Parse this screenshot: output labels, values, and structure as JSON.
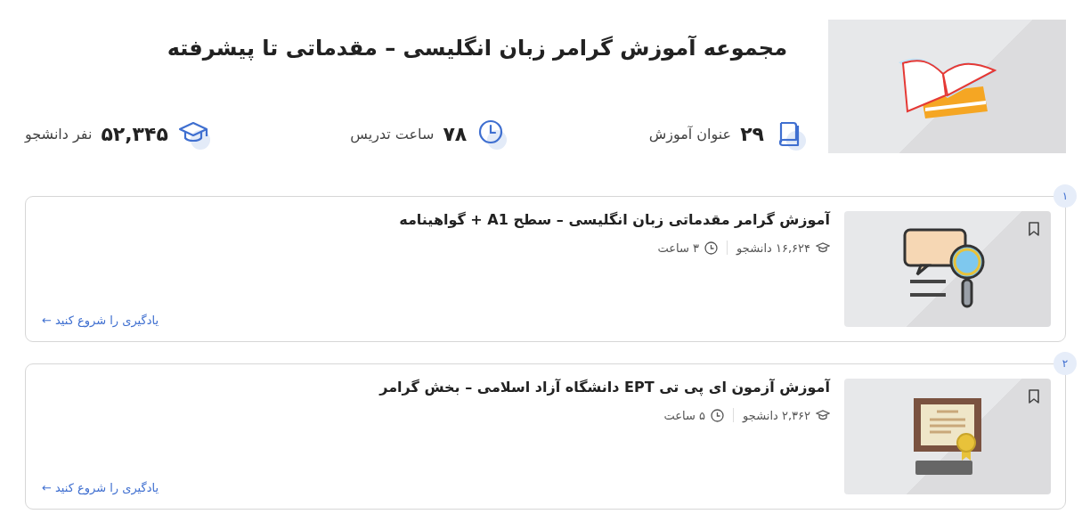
{
  "header": {
    "title": "مجموعه آموزش گرامر زبان انگلیسی – مقدماتی تا پیشرفته",
    "cover": {
      "kind": "books"
    },
    "stats": [
      {
        "kind": "courses",
        "value": "۲۹",
        "label": "عنوان آموزش"
      },
      {
        "kind": "hours",
        "value": "۷۸",
        "label": "ساعت تدریس"
      },
      {
        "kind": "students",
        "value": "۵۲,۳۴۵",
        "label": "نفر دانشجو"
      }
    ]
  },
  "courses": [
    {
      "number": "۱",
      "title": "آموزش گرامر مقدماتی زبان انگلیسی – سطح A1 + گواهینامه",
      "students": "۱۶,۶۲۴ دانشجو",
      "duration": "۳ ساعت",
      "link": "یادگیری را شروع کنید ←",
      "thumbnail": {
        "kind": "abc"
      }
    },
    {
      "number": "۲",
      "title": "آموزش آزمون ای پی تی EPT دانشگاه آزاد اسلامی – بخش گرامر",
      "students": "۲,۳۶۲ دانشجو",
      "duration": "۵ ساعت",
      "link": "یادگیری را شروع کنید ←",
      "thumbnail": {
        "kind": "certificate"
      }
    }
  ]
}
